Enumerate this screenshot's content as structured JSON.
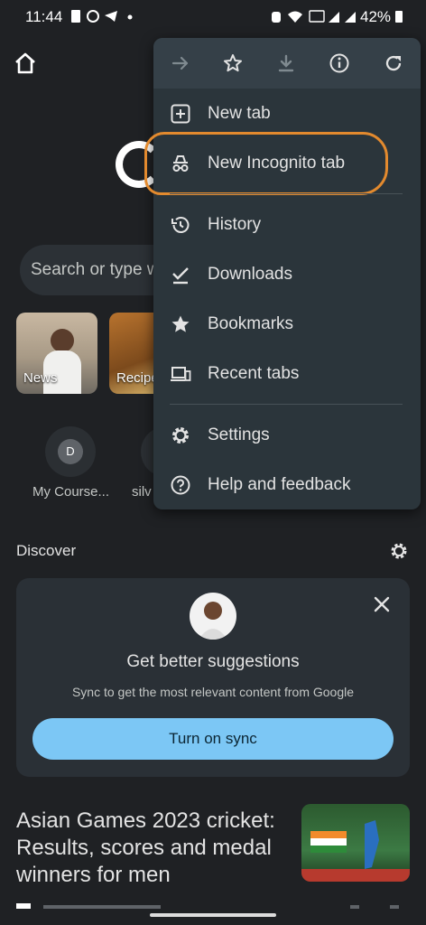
{
  "status_bar": {
    "time": "11:44",
    "battery": "42%"
  },
  "search": {
    "placeholder": "Search or type w"
  },
  "tiles": [
    {
      "label": "News"
    },
    {
      "label": "Recipe"
    }
  ],
  "shortcuts": [
    {
      "initial": "D",
      "label": "My Course..."
    },
    {
      "label": "silv"
    }
  ],
  "discover": {
    "title": "Discover",
    "card": {
      "title": "Get better suggestions",
      "subtitle": "Sync to get the most relevant content from Google",
      "button": "Turn on sync"
    }
  },
  "article": {
    "title": "Asian Games 2023 cricket: Results, scores and medal winners for men"
  },
  "menu": {
    "toolbar": [
      "forward-icon",
      "bookmark-star-icon",
      "download-icon",
      "info-icon",
      "refresh-icon"
    ],
    "items": [
      {
        "label": "New tab",
        "icon": "new-tab-icon"
      },
      {
        "label": "New Incognito tab",
        "icon": "incognito-icon"
      },
      {
        "label": "History",
        "icon": "history-icon"
      },
      {
        "label": "Downloads",
        "icon": "downloads-icon"
      },
      {
        "label": "Bookmarks",
        "icon": "bookmarks-icon"
      },
      {
        "label": "Recent tabs",
        "icon": "recent-tabs-icon"
      },
      {
        "label": "Settings",
        "icon": "settings-icon"
      },
      {
        "label": "Help and feedback",
        "icon": "help-icon"
      }
    ]
  },
  "colors": {
    "background": "#1f2124",
    "menu": "#2b353b",
    "accent": "#7cc7f5",
    "highlight": "#e38a2e"
  }
}
